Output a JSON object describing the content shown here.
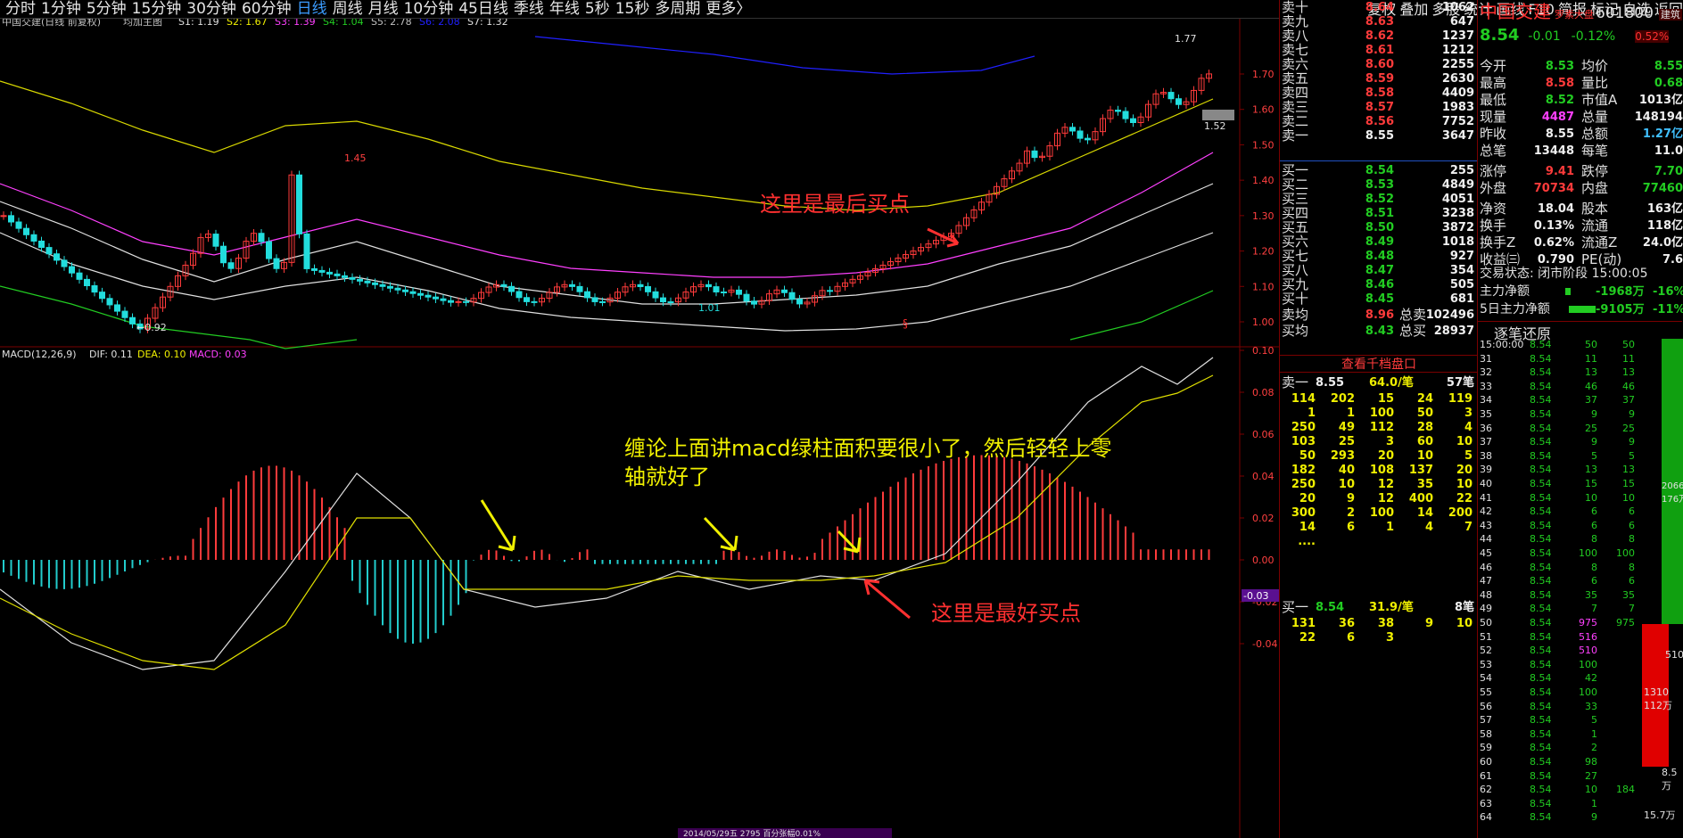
{
  "period_tabs": [
    "分时",
    "1分钟",
    "5分钟",
    "15分钟",
    "30分钟",
    "60分钟",
    "日线",
    "周线",
    "月线",
    "10分钟",
    "45日线",
    "季线",
    "年线",
    "5秒",
    "15秒",
    "多周期",
    "更多〉"
  ],
  "active_period": "日线",
  "toolbar_right": [
    "复权",
    "叠加",
    "多股",
    "统计",
    "画线",
    "F10",
    "简报",
    "标记",
    "自选",
    "返回"
  ],
  "chart_title": "中国交建(日线 前复权)",
  "ma_label": "均加主图",
  "ma_values": [
    {
      "label": "S1: 1.19",
      "color": "#e0e0e0"
    },
    {
      "label": "S2: 1.67",
      "color": "#f0f000"
    },
    {
      "label": "S3: 1.39",
      "color": "#ff40ff"
    },
    {
      "label": "S4: 1.04",
      "color": "#22cc22"
    },
    {
      "label": "S5: 2.78",
      "color": "#c0c0c0"
    },
    {
      "label": "S6: 2.08",
      "color": "#2020ff"
    },
    {
      "label": "S7: 1.32",
      "color": "#e0e0e0"
    }
  ],
  "price_axis": [
    "1.70",
    "1.60",
    "1.50",
    "1.40",
    "1.30",
    "1.20",
    "1.10",
    "1.00"
  ],
  "price_annotations": {
    "high": "1.45",
    "low": "←0.92",
    "mid_low": "1.01",
    "recent_high": "1.77",
    "last": "1.52"
  },
  "macd_label": "MACD(12,26,9)",
  "dif": "DIF: 0.11",
  "dea": "DEA: 0.10",
  "macd": "MACD: 0.03",
  "macd_axis": [
    "0.10",
    "0.08",
    "0.06",
    "0.04",
    "0.02",
    "0.00",
    "-0.02",
    "-0.04"
  ],
  "macd_current": "-0.03",
  "annotation_top": "这里是最后买点",
  "annotation_macd": "缠论上面讲macd绿柱面积要很小了，然后轻轻上零轴就好了",
  "annotation_bottom": "这里是最好买点",
  "bottom_date": "2014/05/29五 2795 百分张幅0.01%",
  "sell_orders": [
    {
      "label": "卖十",
      "price": "8.64",
      "vol": "1062"
    },
    {
      "label": "卖九",
      "price": "8.63",
      "vol": "647"
    },
    {
      "label": "卖八",
      "price": "8.62",
      "vol": "1237"
    },
    {
      "label": "卖七",
      "price": "8.61",
      "vol": "1212"
    },
    {
      "label": "卖六",
      "price": "8.60",
      "vol": "2255"
    },
    {
      "label": "卖五",
      "price": "8.59",
      "vol": "2630"
    },
    {
      "label": "卖四",
      "price": "8.58",
      "vol": "4409"
    },
    {
      "label": "卖三",
      "price": "8.57",
      "vol": "1983"
    },
    {
      "label": "卖二",
      "price": "8.56",
      "vol": "7752"
    },
    {
      "label": "卖一",
      "price": "8.55",
      "vol": "3647"
    }
  ],
  "buy_orders": [
    {
      "label": "买一",
      "price": "8.54",
      "vol": "255"
    },
    {
      "label": "买二",
      "price": "8.53",
      "vol": "4849"
    },
    {
      "label": "买三",
      "price": "8.52",
      "vol": "4051"
    },
    {
      "label": "买四",
      "price": "8.51",
      "vol": "3238"
    },
    {
      "label": "买五",
      "price": "8.50",
      "vol": "3872"
    },
    {
      "label": "买六",
      "price": "8.49",
      "vol": "1018"
    },
    {
      "label": "买七",
      "price": "8.48",
      "vol": "927"
    },
    {
      "label": "买八",
      "price": "8.47",
      "vol": "354"
    },
    {
      "label": "买九",
      "price": "8.46",
      "vol": "505"
    },
    {
      "label": "买十",
      "price": "8.45",
      "vol": "681"
    }
  ],
  "avg_sell": {
    "label": "卖均",
    "price": "8.96",
    "sum_label": "总卖",
    "sum": "102496"
  },
  "avg_buy": {
    "label": "买均",
    "price": "8.43",
    "sum_label": "总买",
    "sum": "28937"
  },
  "view_depth": "查看千档盘口",
  "sell1_queue": {
    "label": "卖一",
    "price": "8.55",
    "per": "64.0/笔",
    "count": "57笔",
    "rows": [
      [
        "114",
        "202",
        "15",
        "24",
        "119"
      ],
      [
        "1",
        "1",
        "100",
        "50",
        "3"
      ],
      [
        "250",
        "49",
        "112",
        "28",
        "4"
      ],
      [
        "103",
        "25",
        "3",
        "60",
        "10"
      ],
      [
        "50",
        "293",
        "20",
        "10",
        "5"
      ],
      [
        "182",
        "40",
        "108",
        "137",
        "20"
      ],
      [
        "250",
        "10",
        "12",
        "35",
        "10"
      ],
      [
        "20",
        "9",
        "12",
        "400",
        "22"
      ],
      [
        "300",
        "2",
        "100",
        "14",
        "200"
      ],
      [
        "14",
        "6",
        "1",
        "4",
        "7"
      ],
      [
        "....",
        "",
        "",
        "",
        ""
      ]
    ]
  },
  "buy1_queue": {
    "label": "买一",
    "price": "8.54",
    "per": "31.9/笔",
    "count": "8笔",
    "rows": [
      [
        "131",
        "36",
        "38",
        "9",
        "10"
      ],
      [
        "22",
        "6",
        "3",
        "",
        ""
      ]
    ]
  },
  "stock": {
    "name": "中国交建",
    "index": "罗素大盘",
    "code": "601800",
    "tag": "建筑",
    "price": "8.54",
    "change": "-0.01",
    "pct": "-0.12%",
    "right_pct": "0.52%"
  },
  "stats": [
    {
      "l": "今开",
      "v": "8.53",
      "c": "green",
      "l2": "均价",
      "v2": "8.55",
      "c2": "green"
    },
    {
      "l": "最高",
      "v": "8.58",
      "c": "red",
      "l2": "量比",
      "v2": "0.68",
      "c2": "green"
    },
    {
      "l": "最低",
      "v": "8.52",
      "c": "green",
      "l2": "市值A",
      "v2": "1013亿",
      "c2": "white"
    },
    {
      "l": "现量",
      "v": "4487",
      "c": "magenta",
      "l2": "总量",
      "v2": "148194",
      "c2": "white"
    },
    {
      "l": "昨收",
      "v": "8.55",
      "c": "white",
      "l2": "总额",
      "v2": "1.27亿",
      "c2": "cyan"
    },
    {
      "l": "总笔",
      "v": "13448",
      "c": "white",
      "l2": "每笔",
      "v2": "11.0",
      "c2": "white"
    },
    {
      "l": "涨停",
      "v": "9.41",
      "c": "red",
      "l2": "跌停",
      "v2": "7.70",
      "c2": "green"
    },
    {
      "l": "外盘",
      "v": "70734",
      "c": "red",
      "l2": "内盘",
      "v2": "77460",
      "c2": "green"
    },
    {
      "l": "净资",
      "v": "18.04",
      "c": "white",
      "l2": "股本",
      "v2": "163亿",
      "c2": "white"
    },
    {
      "l": "换手",
      "v": "0.13%",
      "c": "white",
      "l2": "流通",
      "v2": "118亿",
      "c2": "white"
    },
    {
      "l": "换手Z",
      "v": "0.62%",
      "c": "white",
      "l2": "流通Z",
      "v2": "24.0亿",
      "c2": "white"
    },
    {
      "l": "收益㈢",
      "v": "0.790",
      "c": "white",
      "l2": "PE(动)",
      "v2": "7.6",
      "c2": "white"
    }
  ],
  "trade_status": "交易状态: 闭市阶段 15:00:05",
  "main_flow": {
    "label": "主力净额",
    "v": "-1968万",
    "p": "-16%"
  },
  "flow5": {
    "label": "5日主力净额",
    "v": "-9105万",
    "p": "-11%"
  },
  "ticks_title": "逐笔还原",
  "ticks": [
    {
      "t": "15:00:00",
      "p": "8.54",
      "v": "50",
      "v2": "50"
    },
    {
      "t": "31",
      "p": "8.54",
      "v": "11",
      "v2": "11"
    },
    {
      "t": "32",
      "p": "8.54",
      "v": "13",
      "v2": "13"
    },
    {
      "t": "33",
      "p": "8.54",
      "v": "46",
      "v2": "46"
    },
    {
      "t": "34",
      "p": "8.54",
      "v": "37",
      "v2": "37"
    },
    {
      "t": "35",
      "p": "8.54",
      "v": "9",
      "v2": "9"
    },
    {
      "t": "36",
      "p": "8.54",
      "v": "25",
      "v2": "25"
    },
    {
      "t": "37",
      "p": "8.54",
      "v": "9",
      "v2": "9"
    },
    {
      "t": "38",
      "p": "8.54",
      "v": "5",
      "v2": "5"
    },
    {
      "t": "39",
      "p": "8.54",
      "v": "13",
      "v2": "13"
    },
    {
      "t": "40",
      "p": "8.54",
      "v": "15",
      "v2": "15"
    },
    {
      "t": "41",
      "p": "8.54",
      "v": "10",
      "v2": "10"
    },
    {
      "t": "42",
      "p": "8.54",
      "v": "6",
      "v2": "6"
    },
    {
      "t": "43",
      "p": "8.54",
      "v": "6",
      "v2": "6"
    },
    {
      "t": "44",
      "p": "8.54",
      "v": "8",
      "v2": "8"
    },
    {
      "t": "45",
      "p": "8.54",
      "v": "100",
      "v2": "100"
    },
    {
      "t": "46",
      "p": "8.54",
      "v": "8",
      "v2": "8"
    },
    {
      "t": "47",
      "p": "8.54",
      "v": "6",
      "v2": "6"
    },
    {
      "t": "48",
      "p": "8.54",
      "v": "35",
      "v2": "35"
    },
    {
      "t": "49",
      "p": "8.54",
      "v": "7",
      "v2": "7"
    },
    {
      "t": "50",
      "p": "8.54",
      "v": "975",
      "v2": "975"
    },
    {
      "t": "51",
      "p": "8.54",
      "v": "516",
      "v2": ""
    },
    {
      "t": "52",
      "p": "8.54",
      "v": "510",
      "v2": ""
    },
    {
      "t": "53",
      "p": "8.54",
      "v": "100",
      "v2": ""
    },
    {
      "t": "54",
      "p": "8.54",
      "v": "42",
      "v2": ""
    },
    {
      "t": "55",
      "p": "8.54",
      "v": "100",
      "v2": ""
    },
    {
      "t": "56",
      "p": "8.54",
      "v": "33",
      "v2": ""
    },
    {
      "t": "57",
      "p": "8.54",
      "v": "5",
      "v2": ""
    },
    {
      "t": "58",
      "p": "8.54",
      "v": "1",
      "v2": ""
    },
    {
      "t": "59",
      "p": "8.54",
      "v": "2",
      "v2": ""
    },
    {
      "t": "60",
      "p": "8.54",
      "v": "98",
      "v2": ""
    },
    {
      "t": "61",
      "p": "8.54",
      "v": "27",
      "v2": ""
    },
    {
      "t": "62",
      "p": "8.54",
      "v": "10",
      "v2": "184"
    },
    {
      "t": "63",
      "p": "8.54",
      "v": "1",
      "v2": ""
    },
    {
      "t": "64",
      "p": "8.54",
      "v": "9",
      "v2": ""
    }
  ],
  "tick_side": {
    "green_top": "2066\n176万",
    "red_mid": "1310\n112万",
    "green_bottom": "8.5万",
    "bottom": "15.7万",
    "mid_right": "510"
  }
}
